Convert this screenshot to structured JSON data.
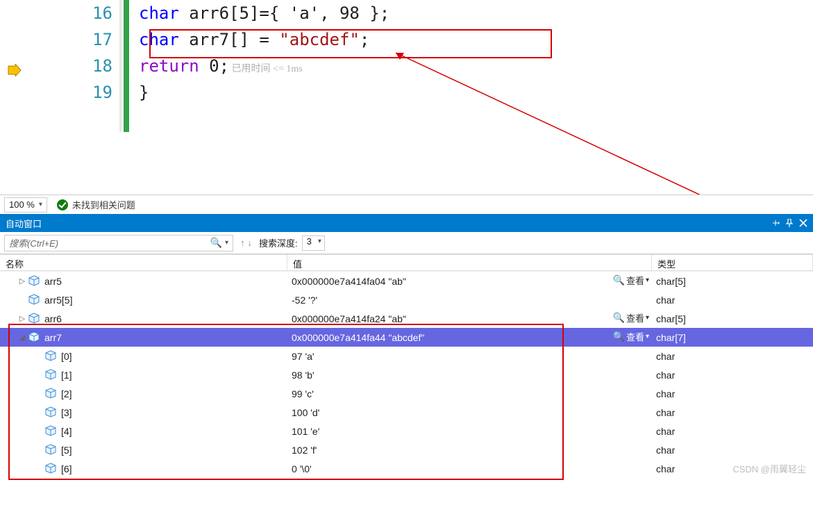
{
  "editor": {
    "lines": [
      "16",
      "17",
      "18",
      "19"
    ],
    "code": {
      "l16_kw": "char",
      "l16_rest": " arr6[5]={ 'a', 98 };",
      "l17_kw": "char",
      "l17_mid": " arr7[] = ",
      "l17_str": "\"abcdef\"",
      "l17_end": ";",
      "l18_ret": "return",
      "l18_rest": " 0;",
      "l18_hint": " 已用时间 <= 1ms",
      "l19": "}"
    }
  },
  "zoombar": {
    "zoom": "100 %",
    "status": "未找到相关问题"
  },
  "panel": {
    "title": "自动窗口",
    "search_placeholder": "搜索(Ctrl+E)",
    "depth_label": "搜索深度:",
    "depth_value": "3",
    "columns": {
      "name": "名称",
      "value": "值",
      "type": "类型"
    },
    "view_label": "查看",
    "rows": [
      {
        "exp": "▷",
        "ind": 1,
        "name": "arr5",
        "value": "0x000000e7a414fa04 \"ab\"",
        "type": "char[5]",
        "view": true,
        "sel": false
      },
      {
        "exp": "",
        "ind": 1,
        "name": "arr5[5]",
        "value": "-52 '?'",
        "type": "char",
        "view": false,
        "sel": false
      },
      {
        "exp": "▷",
        "ind": 1,
        "name": "arr6",
        "value": "0x000000e7a414fa24 \"ab\"",
        "type": "char[5]",
        "view": true,
        "sel": false
      },
      {
        "exp": "◢",
        "ind": 1,
        "name": "arr7",
        "value": "0x000000e7a414fa44 \"abcdef\"",
        "type": "char[7]",
        "view": true,
        "sel": true
      },
      {
        "exp": "",
        "ind": 2,
        "name": "[0]",
        "value": "97 'a'",
        "type": "char",
        "view": false,
        "sel": false
      },
      {
        "exp": "",
        "ind": 2,
        "name": "[1]",
        "value": "98 'b'",
        "type": "char",
        "view": false,
        "sel": false
      },
      {
        "exp": "",
        "ind": 2,
        "name": "[2]",
        "value": "99 'c'",
        "type": "char",
        "view": false,
        "sel": false
      },
      {
        "exp": "",
        "ind": 2,
        "name": "[3]",
        "value": "100 'd'",
        "type": "char",
        "view": false,
        "sel": false
      },
      {
        "exp": "",
        "ind": 2,
        "name": "[4]",
        "value": "101 'e'",
        "type": "char",
        "view": false,
        "sel": false
      },
      {
        "exp": "",
        "ind": 2,
        "name": "[5]",
        "value": "102 'f'",
        "type": "char",
        "view": false,
        "sel": false
      },
      {
        "exp": "",
        "ind": 2,
        "name": "[6]",
        "value": "0 '\\0'",
        "type": "char",
        "view": false,
        "sel": false
      }
    ]
  },
  "watermark": "CSDN @雨翼轻尘"
}
